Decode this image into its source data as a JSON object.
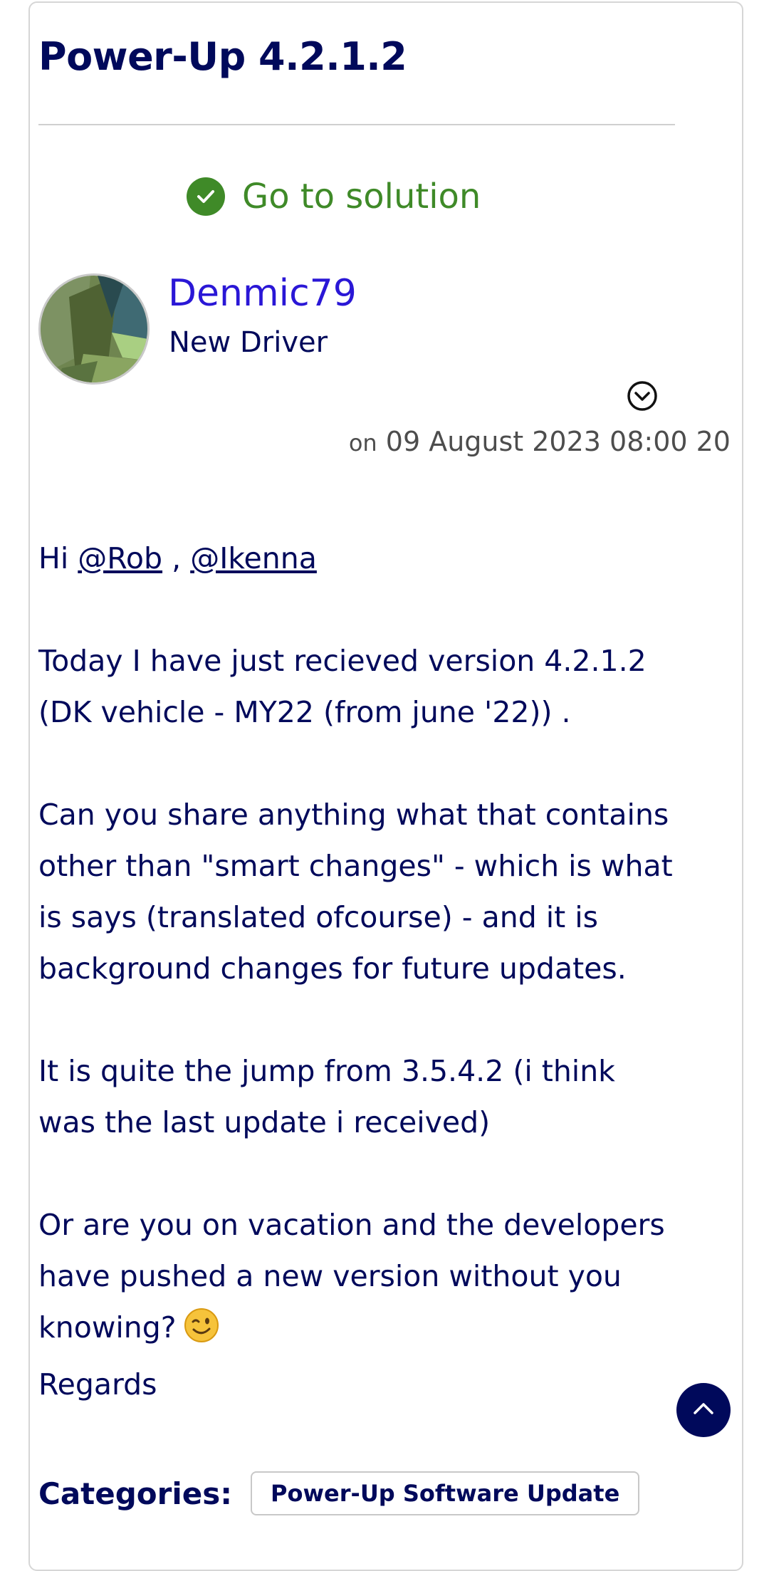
{
  "post": {
    "title": "Power-Up 4.2.1.2",
    "solution_link": "Go to solution",
    "author": {
      "name": "Denmic79",
      "rank": "New Driver"
    },
    "date_prefix": "on",
    "date": "09 August 2023 08:00 20",
    "body": {
      "greeting_prefix": "Hi",
      "mention_1": "@Rob",
      "separator": ",",
      "mention_2": "@Ikenna",
      "p1": "Today I have just recieved version 4.2.1.2 (DK vehicle - MY22 (from june '22)) .",
      "p2": "Can you share anything what that contains other than \"smart changes\" - which is what is says (translated ofcourse) - and it is background changes for future updates.",
      "p3": "It is quite the jump from 3.5.4.2 (i think was the last update i received)",
      "p4": "Or are you on vacation and the developers have pushed a new version without you knowing?",
      "p5": "Regards"
    },
    "categories_label": "Categories:",
    "category_tag": "Power-Up Software Update"
  },
  "icons": {
    "check": "check-circle-icon",
    "options": "chevron-down-circle-icon",
    "emoji": "winking-face-icon",
    "back_to_top": "chevron-up-icon"
  },
  "colors": {
    "text": "#00095b",
    "solution": "#3f8a28",
    "username": "#2a17d6",
    "muted": "#4d4d4d"
  }
}
